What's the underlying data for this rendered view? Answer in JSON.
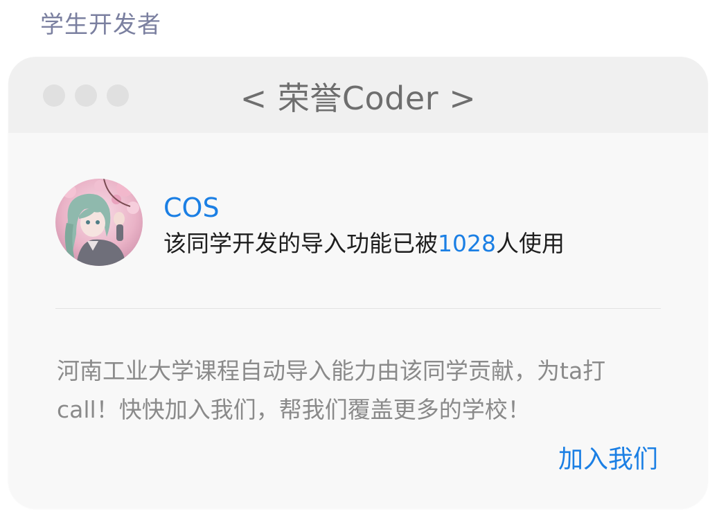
{
  "section": {
    "title": "学生开发者"
  },
  "card": {
    "title": "< 荣誉Coder >",
    "developer": {
      "name": "COS",
      "stat_prefix": "该同学开发的导入功能已被",
      "stat_count": "1028",
      "stat_suffix": "人使用"
    },
    "description": "河南工业大学课程自动导入能力由该同学贡献，为ta打call！快快加入我们，帮我们覆盖更多的学校！",
    "join_label": "加入我们"
  },
  "colors": {
    "accent": "#1b7fe4",
    "section_title": "#7b80a0",
    "card_bg": "#f8f8f8",
    "header_bg": "#f0f0f0"
  }
}
